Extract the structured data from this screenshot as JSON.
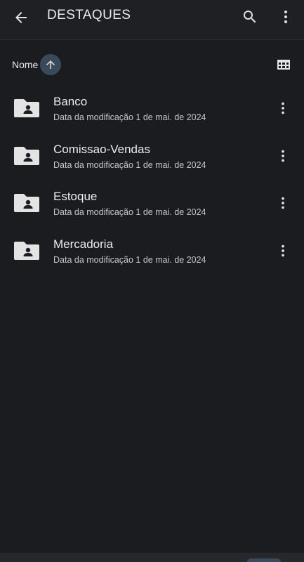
{
  "appbar": {
    "title": "DESTAQUES",
    "back_icon": "arrow-left-icon",
    "search_icon": "search-icon",
    "more_icon": "more-vertical-icon"
  },
  "sort": {
    "label": "Nome",
    "direction_icon": "arrow-up-icon",
    "view_toggle_icon": "grid-view-icon"
  },
  "folders": [
    {
      "name": "Banco",
      "meta": "Data da modificação 1 de mai. de 2024"
    },
    {
      "name": "Comissao-Vendas",
      "meta": "Data da modificação 1 de mai. de 2024"
    },
    {
      "name": "Estoque",
      "meta": "Data da modificação 1 de mai. de 2024"
    },
    {
      "name": "Mercadoria",
      "meta": "Data da modificação 1 de mai. de 2024"
    }
  ],
  "colors": {
    "background": "#1b1c20",
    "appbar": "#1f2024",
    "icon": "#e3e3e3",
    "sort_accent": "#3b4a5a"
  }
}
